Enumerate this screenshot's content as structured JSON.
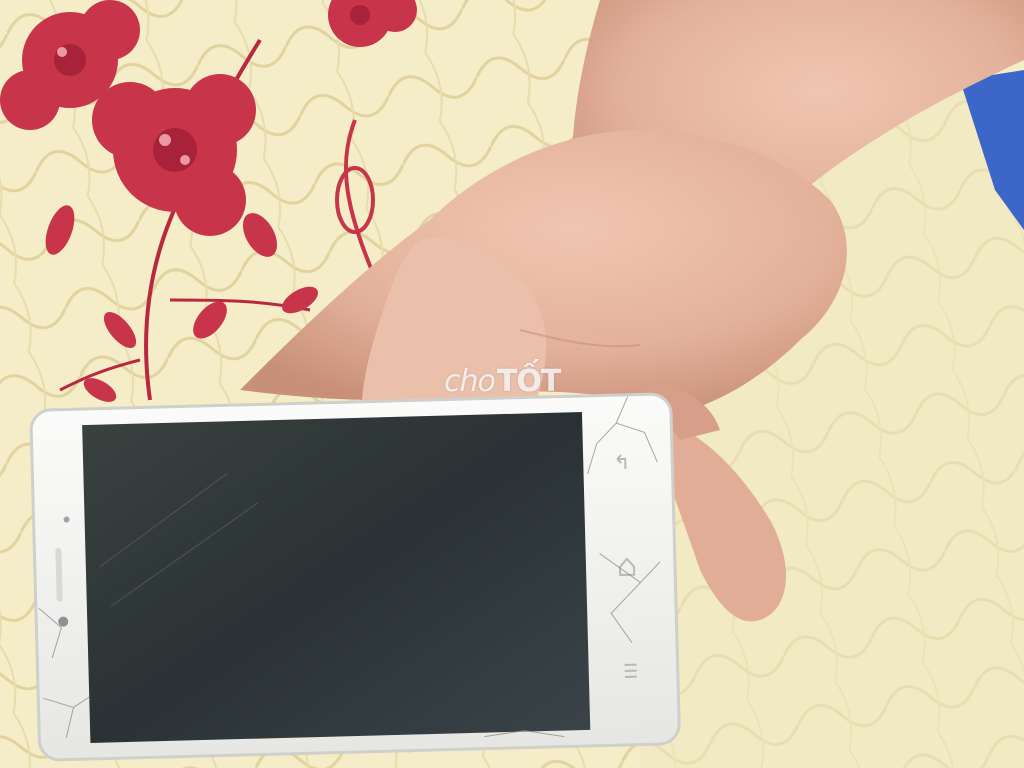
{
  "watermark": {
    "part1": "cho",
    "part2": "TỐT"
  },
  "colors": {
    "bedspread": "#f3ecc4",
    "quilt_stitch": "#e5d7a3",
    "flower": "#c8344a",
    "flower_dark": "#a8223a",
    "skin": "#e7b9a3",
    "skin_shadow": "#c98f78",
    "phone_body": "#f4f4f2",
    "phone_screen": "#2c3436",
    "pillow_blue": "#3c66c8"
  },
  "icons": [
    "back-icon",
    "home-icon",
    "menu-icon",
    "front-camera-icon",
    "earpiece-icon"
  ]
}
